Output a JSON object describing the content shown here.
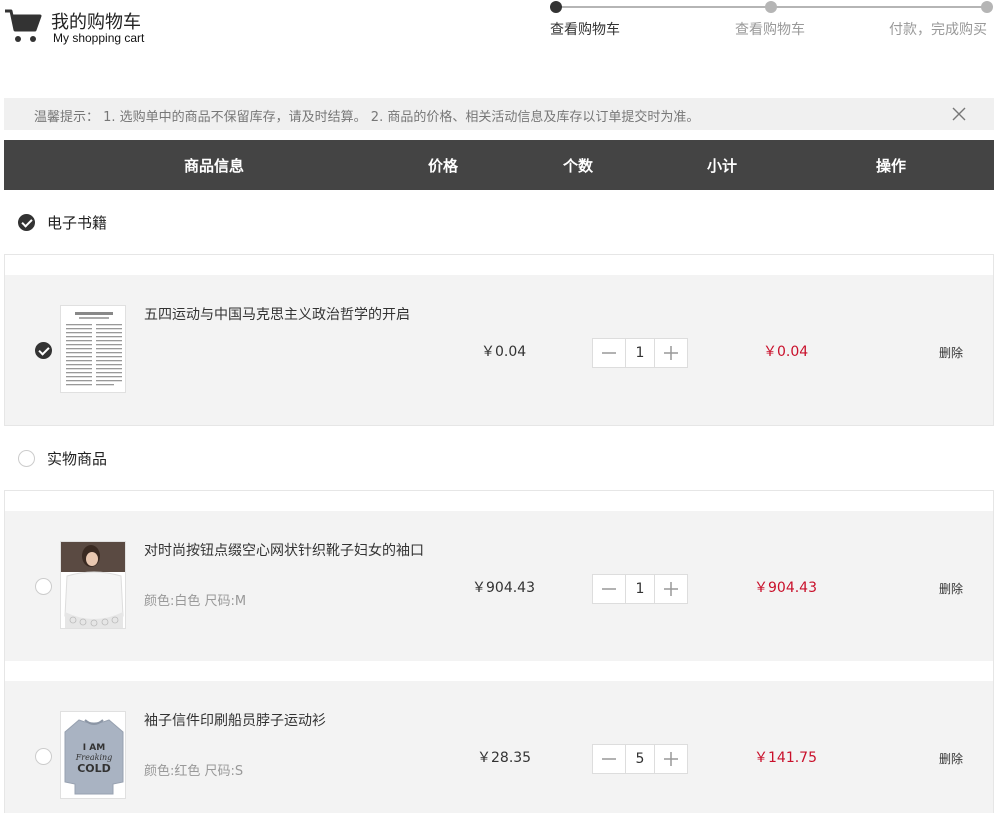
{
  "header": {
    "title": "我的购物车",
    "subtitle": "My shopping cart",
    "logo_icon": "shopping-cart-icon"
  },
  "steps": [
    {
      "label": "查看购物车",
      "active": true
    },
    {
      "label": "查看购物车",
      "active": false
    },
    {
      "label": "付款，完成购买",
      "active": false
    }
  ],
  "notice": {
    "text": "温馨提示： 1. 选购单中的商品不保留库存，请及时结算。 2. 商品的价格、相关活动信息及库存以订单提交时为准。",
    "close_icon": "close-icon"
  },
  "table_header": {
    "info": "商品信息",
    "price": "价格",
    "qty": "个数",
    "subtotal": "小计",
    "action": "操作"
  },
  "groups": [
    {
      "name": "电子书籍",
      "checked": true,
      "items": [
        {
          "name": "五四运动与中国马克思主义政治哲学的开启",
          "attrs": "",
          "price": "￥0.04",
          "qty": "1",
          "subtotal": "￥0.04",
          "delete": "删除",
          "checked": true
        }
      ]
    },
    {
      "name": "实物商品",
      "checked": false,
      "items": [
        {
          "name": "对时尚按钮点缀空心网状针织靴子妇女的袖口",
          "attrs": "颜色:白色  尺码:M",
          "price": "￥904.43",
          "qty": "1",
          "subtotal": "￥904.43",
          "delete": "删除",
          "checked": false
        },
        {
          "name": "袖子信件印刷船员脖子运动衫",
          "attrs": "颜色:红色  尺码:S",
          "price": "￥28.35",
          "qty": "5",
          "subtotal": "￥141.75",
          "delete": "删除",
          "checked": false
        }
      ]
    }
  ],
  "thumb_sweater_text": [
    "I AM",
    "Freaking",
    "COLD"
  ],
  "colors": {
    "header_bg": "#444444",
    "price_red": "#c9102b",
    "notice_bg": "#f0f0f0",
    "row_bg": "#f3f3f3"
  }
}
